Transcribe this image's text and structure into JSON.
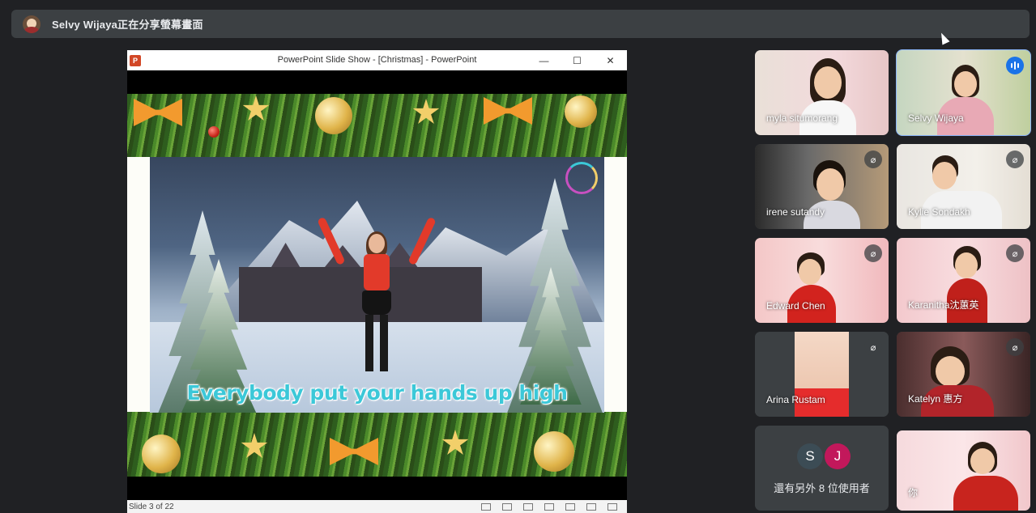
{
  "presenter": {
    "text": "Selvy Wijaya正在分享螢幕畫面"
  },
  "ppt": {
    "window_title": "PowerPoint Slide Show - [Christmas] - PowerPoint",
    "logo_letter": "P",
    "minimize": "—",
    "maximize": "☐",
    "close": "✕",
    "slide_caption": "Everybody put your hands up high",
    "status": "Slide 3 of 22"
  },
  "participants": [
    {
      "name": "myla situmorang",
      "muted": false
    },
    {
      "name": "Selvy Wijaya",
      "muted": false,
      "speaking": true
    },
    {
      "name": "irene sutandy",
      "muted": true
    },
    {
      "name": "Kylie Sondakh",
      "muted": true
    },
    {
      "name": "Edward Chen",
      "muted": true
    },
    {
      "name": "Karanitha沈蕙英",
      "muted": true
    },
    {
      "name": "Arina Rustam",
      "muted": true
    },
    {
      "name": "Katelyn 惠方",
      "muted": true
    },
    {
      "name": "你",
      "muted": false
    }
  ],
  "more": {
    "avatar1": "S",
    "avatar2": "J",
    "avatar1_color": "#3c4c55",
    "avatar2_color": "#c2185b",
    "text": "還有另外 8 位使用者"
  },
  "colors": {
    "background": "#202124",
    "tile": "#3c4043",
    "active_outline": "#8ab4f8",
    "speaking": "#1a73e8"
  },
  "icons": {
    "mic_off": "mic-off-icon",
    "speaking": "audio-level-icon",
    "cursor": "mouse-cursor-icon"
  }
}
